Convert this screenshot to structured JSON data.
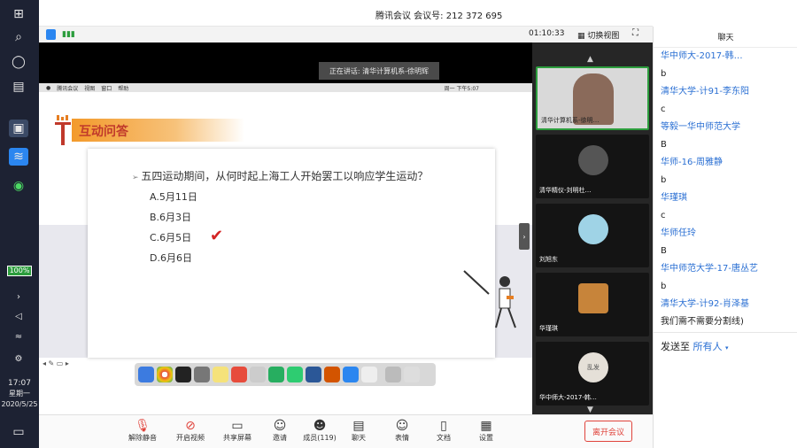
{
  "window": {
    "title": "腾讯会议 会议号: 212 372 695"
  },
  "top_toolbar": {
    "timer": "01:10:33",
    "view_switch": "切换视图"
  },
  "video": {
    "speaking": "正在讲话: 清华计算机系-徐明辉",
    "mac_menu": [
      "腾讯会议",
      "视图",
      "窗口",
      "帮助"
    ],
    "mac_clock": "周一 下午5:07"
  },
  "slide": {
    "title": "互动问答",
    "question": "五四运动期间，从何时起上海工人开始罢工以响应学生运动？",
    "options": [
      "A.5月11日",
      "B.6月3日",
      "C.6月5日",
      "D.6月6日"
    ],
    "correct_mark": "✔"
  },
  "gallery": {
    "tiles": [
      {
        "name": "清华计算机系-徐明…"
      },
      {
        "name": "清华精仪-刘明杜…"
      },
      {
        "name": "刘旭东"
      },
      {
        "name": "华瑾琪"
      },
      {
        "name": "华中师大-2017-韩…",
        "avatar_text": "乱发"
      }
    ]
  },
  "taskbar": {
    "battery": "100%",
    "time": "17:07",
    "weekday": "星期一",
    "date": "2020/5/25"
  },
  "toolbar": {
    "buttons": [
      {
        "label": "解除静音",
        "icon": "mic-muted-icon"
      },
      {
        "label": "开启视频",
        "icon": "camera-off-icon"
      },
      {
        "label": "共享屏幕",
        "icon": "share-screen-icon"
      },
      {
        "label": "邀请",
        "icon": "invite-icon"
      },
      {
        "label": "成员(119)",
        "icon": "members-icon"
      },
      {
        "label": "聊天",
        "icon": "chat-icon"
      },
      {
        "label": "表情",
        "icon": "emoji-icon"
      },
      {
        "label": "文档",
        "icon": "document-icon"
      },
      {
        "label": "设置",
        "icon": "settings-icon"
      }
    ],
    "leave": "离开会议"
  },
  "chat": {
    "title": "聊天",
    "messages": [
      {
        "type": "name",
        "text": "华中师大-2017-韩…"
      },
      {
        "type": "text",
        "text": "b"
      },
      {
        "type": "name",
        "text": "清华大学-计91-李东阳"
      },
      {
        "type": "text",
        "text": "c"
      },
      {
        "type": "name",
        "text": "等毅一华中师范大学"
      },
      {
        "type": "text",
        "text": "B"
      },
      {
        "type": "name",
        "text": "华师-16-周雅静"
      },
      {
        "type": "text",
        "text": "b"
      },
      {
        "type": "name",
        "text": "华瑾琪"
      },
      {
        "type": "text",
        "text": "c"
      },
      {
        "type": "name",
        "text": "华师任玲"
      },
      {
        "type": "text",
        "text": "B"
      },
      {
        "type": "name",
        "text": "华中师范大学-17-唐丛艺"
      },
      {
        "type": "text",
        "text": "b"
      },
      {
        "type": "name",
        "text": "清华大学-计92-肖泽基"
      },
      {
        "type": "text",
        "text": "我们需不需要分割线)"
      }
    ],
    "send_to_label": "发送至",
    "send_to_target": "所有人"
  }
}
